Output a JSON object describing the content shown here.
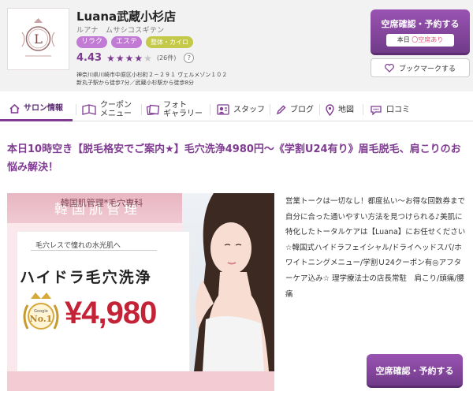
{
  "shop": {
    "name": "Luana武蔵小杉店",
    "kana": "ルアナ　ムサシコスギテン",
    "tags": [
      "リラク",
      "エステ",
      "整体・カイロ"
    ],
    "rating": "4.43",
    "stars_value": 4.43,
    "review_count": "(26件)",
    "help_label": "?",
    "address_line1": "神奈川県川崎市中原区小杉町２－２９１ ヴェルメゾン１０２",
    "address_line2": "新丸子駅から徒歩7分／武蔵小杉駅から徒歩8分",
    "logo_letter": "L"
  },
  "cta": {
    "reserve_label": "空席確認・予約する",
    "today_label": "本日",
    "vacancy_status": "〇空席あり",
    "bookmark_label": "ブックマークする",
    "bottom_reserve_label": "空席確認・予約する"
  },
  "tabs": [
    {
      "label": "サロン情報",
      "icon": "home-icon",
      "active": true
    },
    {
      "label": "クーポン\nメニュー",
      "icon": "coupon-icon",
      "active": false
    },
    {
      "label": "フォト\nギャラリー",
      "icon": "photo-icon",
      "active": false
    },
    {
      "label": "スタッフ",
      "icon": "staff-icon",
      "active": false
    },
    {
      "label": "ブログ",
      "icon": "pencil-icon",
      "active": false
    },
    {
      "label": "地図",
      "icon": "map-pin-icon",
      "active": false
    },
    {
      "label": "口コミ",
      "icon": "chat-icon",
      "active": false
    }
  ],
  "main": {
    "headline": "本日10時空き【脱毛格安でご案内★】毛穴洗浄4980円～《学割U24有り》眉毛脱毛、肩こりのお悩み解決！",
    "banner": {
      "title": "韓国肌管理",
      "subtitle": "毛穴レスで憧れの水光肌へ",
      "main_text": "ハイドラ毛穴洗浄",
      "price": "¥4,980",
      "footer": "韓国肌管理*毛穴専科",
      "badge_top": "Google",
      "badge_mid": "No.1"
    },
    "description": "営業トークは一切なし！都度払い～お得な回数券まで自分に合った通いやすい方法を見つけられる♪美肌に特化したトータルケアは【Luana】にお任せください☆韓国式ハイドラフェイシャル/ドライヘッドスパ/ホワイトニングメニュー/学割Ｕ24クーポン有◎アフターケア込み☆ 理学療法士の店長常駐　肩こり/頭痛/腰痛"
  },
  "colors": {
    "brand": "#7f3b91",
    "tag": "#c27bd4",
    "tag_lime": "#c4c94a",
    "price": "#c42337"
  }
}
